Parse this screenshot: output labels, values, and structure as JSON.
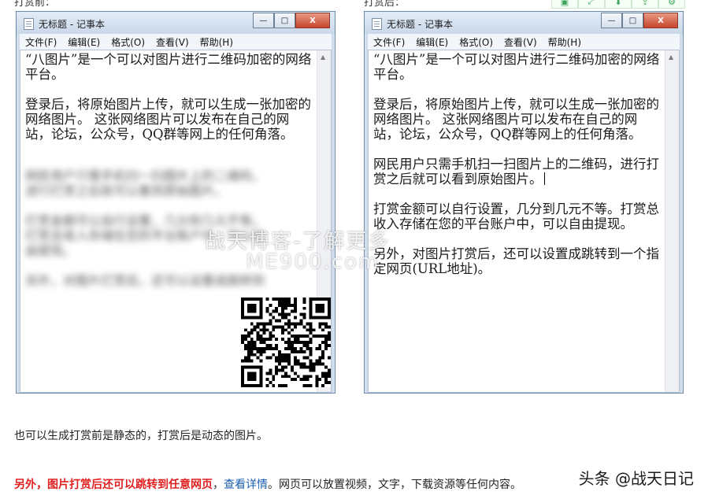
{
  "top_labels": {
    "left": "打赏前：",
    "right": "打赏后："
  },
  "toolbar": {
    "icons": [
      "save-icon",
      "expand-icon",
      "download-icon",
      "export-icon",
      "settings-icon"
    ]
  },
  "notepad": {
    "title": "无标题 - 记事本",
    "menu": [
      "文件(F)",
      "编辑(E)",
      "格式(O)",
      "查看(V)",
      "帮助(H)"
    ],
    "min_glyph": "—",
    "max_glyph": "□",
    "close_glyph": "X"
  },
  "before": {
    "visible_text": "“八图片”是一个可以对图片进行二维码加密的网络平台。\n\n登录后，将原始图片上传，就可以生成一张加密的网络图片。 这张网络图片可以发布在自己的网站，论坛，公众号，QQ群等网上的任何角落。",
    "blurred_lines": [
      "网民用户只需手机扫一扫图片上的二维码，",
      "进行打赏之后就可以看到原始图片。",
      "",
      "打赏金额可以自行设置，几分到几元不等。",
      "打赏总收入存储在您的平台账户中，可以自",
      "由提现。",
      "",
      "另外，对图片打赏后，还可以设置成跳转到"
    ]
  },
  "after": {
    "text": "“八图片”是一个可以对图片进行二维码加密的网络平台。\n\n登录后，将原始图片上传，就可以生成一张加密的网络图片。 这张网络图片可以发布在自己的网站，论坛，公众号，QQ群等网上的任何角落。\n\n网民用户只需手机扫一扫图片上的二维码，进行打赏之后就可以看到原始图片。",
    "text2": "\n\n打赏金额可以自行设置，几分到几元不等。打赏总收入存储在您的平台账户中，可以自由提现。\n\n另外，对图片打赏后，还可以设置成跳转到一个指定网页(URL地址)。"
  },
  "watermark": {
    "line1": "战天博客-了解更多",
    "line2": "ME900.com"
  },
  "body": {
    "p1": "也可以生成打赏前是静态的，打赏后是动态的图片。",
    "p2_red": "另外，图片打赏后还可以跳转到任意网页",
    "p2_sep": "，",
    "p2_link": "查看详情",
    "p2_rest": "。网页可以放置视频，文字，下载资源等任何内容。"
  },
  "credit": "头条 @战天日记"
}
